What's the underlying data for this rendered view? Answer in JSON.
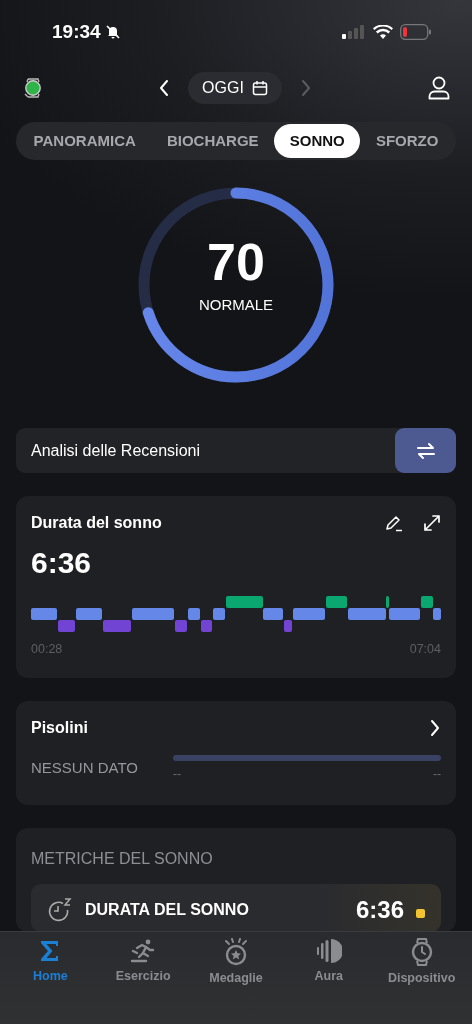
{
  "status_bar": {
    "time": "19:34"
  },
  "header": {
    "date_label": "OGGI",
    "device_connected": true
  },
  "tabs": [
    {
      "label": "PANORAMICA",
      "selected": false
    },
    {
      "label": "BIOCHARGE",
      "selected": false
    },
    {
      "label": "SONNO",
      "selected": true
    },
    {
      "label": "SFORZO",
      "selected": false
    }
  ],
  "score": {
    "value": "70",
    "label": "NORMALE",
    "level": 0.7
  },
  "analysis_bar": {
    "label": "Analisi delle Recensioni"
  },
  "sleep_duration_card": {
    "title": "Durata del sonno",
    "value": "6:36",
    "start_time": "00:28",
    "end_time": "07:04"
  },
  "naps_card": {
    "title": "Pisolini",
    "empty_label": "NESSUN DATO",
    "axis_start": "--",
    "axis_end": "--"
  },
  "metrics": {
    "title": "METRICHE DEL SONNO",
    "items": [
      {
        "label": "DURATA DEL SONNO",
        "value": "6:36",
        "color": "#f2c530"
      }
    ]
  },
  "bottom_nav": [
    {
      "label": "Home",
      "selected": true
    },
    {
      "label": "Esercizio",
      "selected": false
    },
    {
      "label": "Medaglie",
      "selected": false
    },
    {
      "label": "Aura",
      "selected": false
    },
    {
      "label": "Dispositivo",
      "selected": false
    }
  ]
}
